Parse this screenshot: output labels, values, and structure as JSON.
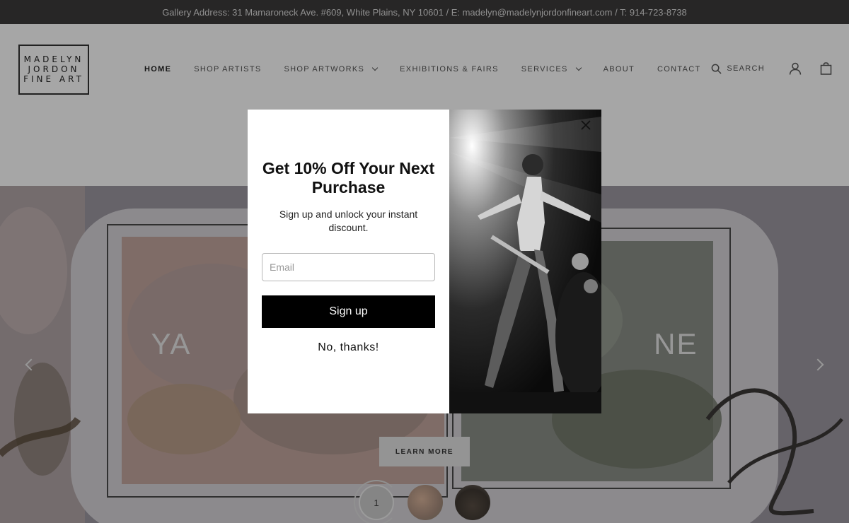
{
  "announcement": "Gallery Address: 31 Mamaroneck Ave. #609, White Plains, NY 10601 / E: madelyn@madelynjordonfineart.com / T: 914-723-8738",
  "logo": {
    "lines": [
      "MADELYN",
      "JORDON",
      "FINE ART"
    ]
  },
  "nav": {
    "home": "HOME",
    "shop_artists": "SHOP ARTISTS",
    "shop_artworks": "SHOP ARTWORKS",
    "exhibitions": "EXHIBITIONS & FAIRS",
    "services": "SERVICES",
    "about": "ABOUT",
    "contact": "CONTACT"
  },
  "utility": {
    "search_label": "SEARCH",
    "icons": [
      "search-icon",
      "account-icon",
      "cart-icon"
    ]
  },
  "hero": {
    "title": "YA                                                NE",
    "learn_more": "LEARN MORE",
    "slide_indicator": "1",
    "icons": [
      "chevron-left-icon",
      "chevron-right-icon"
    ]
  },
  "popup": {
    "title": "Get 10% Off Your Next Purchase",
    "subtitle": "Sign up and unlock your instant discount.",
    "email_placeholder": "Email",
    "signup_label": "Sign up",
    "no_thanks_label": "No, thanks!",
    "icons": [
      "close-icon"
    ]
  },
  "colors": {
    "announcement_bg": "#3d3b3b",
    "button_bg": "#000000",
    "overlay": "rgba(0,0,0,0.35)"
  }
}
